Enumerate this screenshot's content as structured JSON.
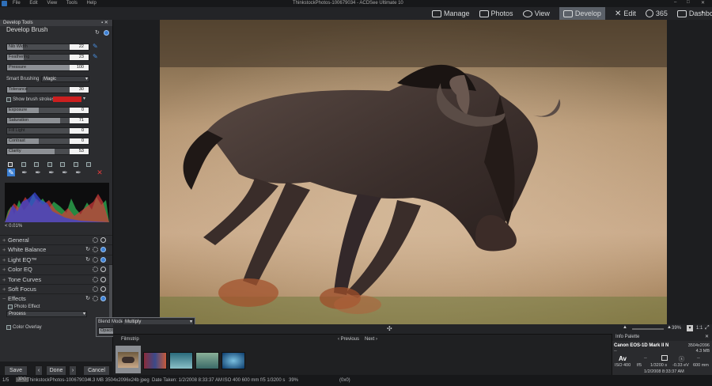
{
  "window": {
    "title": "ThinkstockPhotos-100679034 - ACDSee Ultimate 10"
  },
  "menu": [
    "File",
    "Edit",
    "View",
    "Tools",
    "Help"
  ],
  "modes": [
    {
      "label": "Manage",
      "icon": "grid-icon"
    },
    {
      "label": "Photos",
      "icon": "photos-icon"
    },
    {
      "label": "View",
      "icon": "eye-icon"
    },
    {
      "label": "Develop",
      "icon": "develop-icon",
      "active": true
    },
    {
      "label": "Edit",
      "icon": "edit-icon"
    },
    {
      "label": "365",
      "icon": "cloud-365-icon"
    },
    {
      "label": "Dashboard",
      "icon": "dashboard-icon"
    }
  ],
  "panel": {
    "title": "Develop Tools",
    "brush_title": "Develop Brush",
    "nib_width": {
      "label": "Nib Width",
      "value": "22",
      "level": 0.25
    },
    "feathering": {
      "label": "Feathering",
      "value": "23",
      "level": 0.26
    },
    "pressure": {
      "label": "Pressure",
      "value": "100",
      "level": 1.0
    },
    "smart_brushing_label": "Smart Brushing",
    "smart_brushing_value": "Magic",
    "tolerance": {
      "label": "Tolerance",
      "value": "30",
      "level": 0.3
    },
    "show_strokes_label": "Show brush strokes",
    "stroke_color": "#cc1f1f",
    "adjustments": [
      {
        "label": "Exposure",
        "value": "0",
        "level": 0.5
      },
      {
        "label": "Saturation",
        "value": "71",
        "level": 0.85
      },
      {
        "label": "Fill Light",
        "value": "0",
        "level": 0.0
      },
      {
        "label": "Contrast",
        "value": "0",
        "level": 0.5
      },
      {
        "label": "Clarity",
        "value": "53",
        "level": 0.76
      }
    ],
    "histogram_readout": "< 0.01%",
    "sections": [
      "General",
      "White Balance",
      "Light EQ™",
      "Color EQ",
      "Tone Curves",
      "Soft Focus",
      "Effects"
    ],
    "photo_effect_label": "Photo Effect",
    "process_label": "Process",
    "color_overlay_label": "Color Overlay"
  },
  "buttons": {
    "save": "Save",
    "done": "Done",
    "cancel": "Cancel"
  },
  "blend_popup": {
    "mode_label": "Blend Mode:",
    "mode_value": "Multiply",
    "opacity_label": "Opacity",
    "opacity_value": "35",
    "opacity_level": 0.35
  },
  "view_toolbar": {
    "zoom": "39%",
    "ratio": "1:1"
  },
  "filmstrip": {
    "title": "Filmstrip",
    "previous": "Previous",
    "next": "Next"
  },
  "info_palette": {
    "title": "Info Palette",
    "camera": "Canon EOS-1D Mark II N",
    "dimensions": "3504x2096",
    "filesize": "4.3 MB",
    "dashes": "--",
    "iso": "ISO 400",
    "aperture": "f/5",
    "shutter": "1/3200 s",
    "ev": "-0.33 eV",
    "focal": "600 mm",
    "datetime": "1/2/2008 8:33:37 AM",
    "av": "Av"
  },
  "status": {
    "count": "1/5",
    "format": "JPG",
    "filename": "ThinkstockPhotos-100679034",
    "size": "4.3 MB",
    "dims": "3504x2096x24b jpeg",
    "date": "Date Taken: 1/2/2008 8:33:37 AM",
    "exif": "ISO 400   600 mm   f/5   1/3200 s",
    "zoom": "39%",
    "coords": "(0x0)"
  }
}
